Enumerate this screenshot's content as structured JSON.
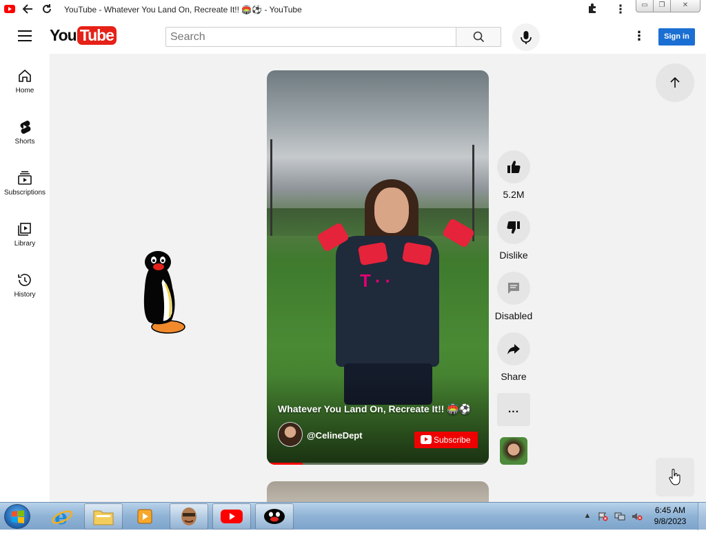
{
  "window": {
    "title": "YouTube - Whatever You Land On, Recreate It!! 🏟️⚽ - YouTube",
    "controls": [
      "minimize",
      "restore",
      "close"
    ]
  },
  "header": {
    "logo_you": "You",
    "logo_tube": "Tube",
    "search_placeholder": "Search",
    "sign_in_label": "Sign in"
  },
  "sidebar": {
    "items": [
      {
        "label": "Home",
        "icon": "home-icon"
      },
      {
        "label": "Shorts",
        "icon": "shorts-icon"
      },
      {
        "label": "Subscriptions",
        "icon": "subscriptions-icon"
      },
      {
        "label": "Library",
        "icon": "library-icon"
      },
      {
        "label": "History",
        "icon": "history-icon"
      }
    ]
  },
  "short": {
    "title": "Whatever You Land On, Recreate It!! 🏟️⚽",
    "channel": "@CelineDept",
    "subscribe_label": "Subscribe",
    "progress_fraction": 0.16,
    "actions": {
      "like_count": "5.2M",
      "dislike_label": "Dislike",
      "comments_label": "Disabled",
      "share_label": "Share",
      "more_label": "..."
    }
  },
  "taskbar": {
    "time": "6:45 AM",
    "date": "9/8/2023",
    "apps": [
      "internet-explorer",
      "file-explorer",
      "media-player",
      "game-app",
      "youtube",
      "pingu-app"
    ]
  },
  "colors": {
    "youtube_red": "#ff0000",
    "sign_in_blue": "#1b6fd3",
    "main_bg": "#f2f2f2"
  }
}
